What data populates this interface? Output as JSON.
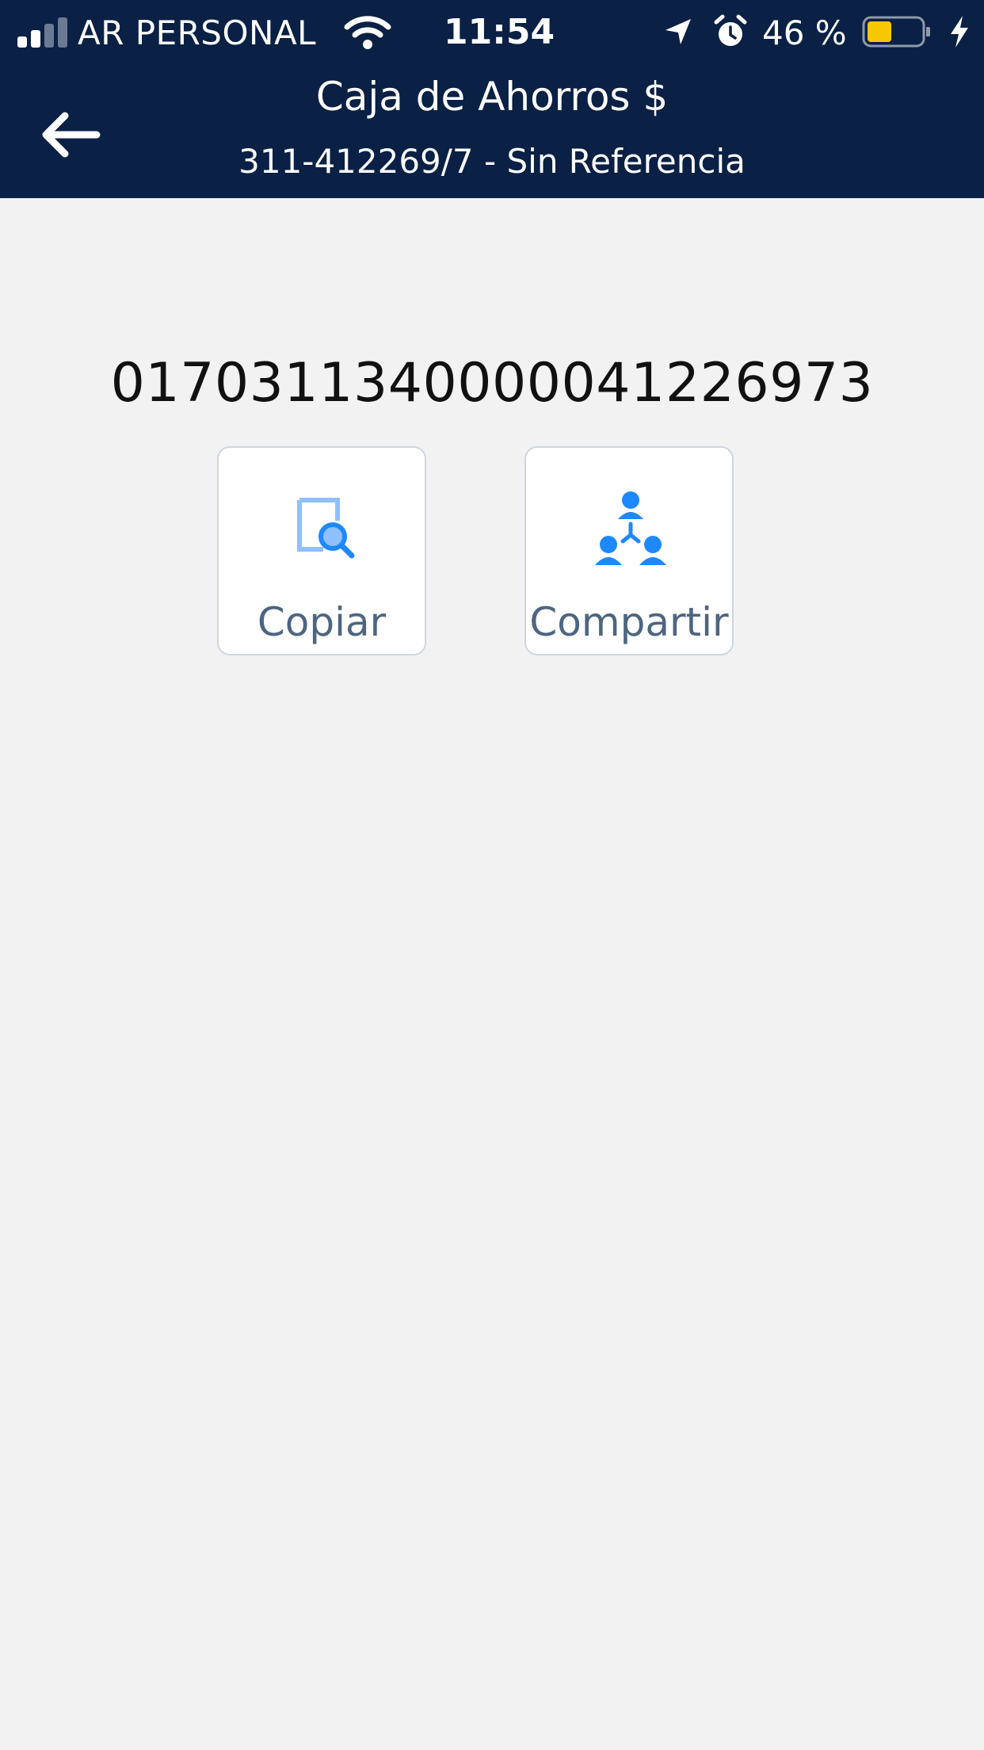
{
  "status_bar": {
    "carrier": "AR PERSONAL",
    "time": "11:54",
    "battery_percent": "46 %",
    "battery_level": 0.46,
    "battery_color": "#f6c800",
    "icons": [
      "signal-icon",
      "wifi-icon",
      "location-arrow-icon",
      "alarm-clock-icon",
      "battery-icon",
      "charging-bolt-icon"
    ]
  },
  "header": {
    "back_icon": "arrow-left-icon",
    "title": "Caja de Ahorros $",
    "subtitle": "311-412269/7 - Sin Referencia",
    "background": "#0a2044"
  },
  "main": {
    "account_number": "0170311340000041226973",
    "actions": [
      {
        "label": "Copiar",
        "icon": "copy-search-icon"
      },
      {
        "label": "Compartir",
        "icon": "share-people-icon"
      }
    ]
  },
  "colors": {
    "background": "#f2f2f3",
    "accent_blue": "#1e88ff",
    "action_label": "#4d6580"
  }
}
